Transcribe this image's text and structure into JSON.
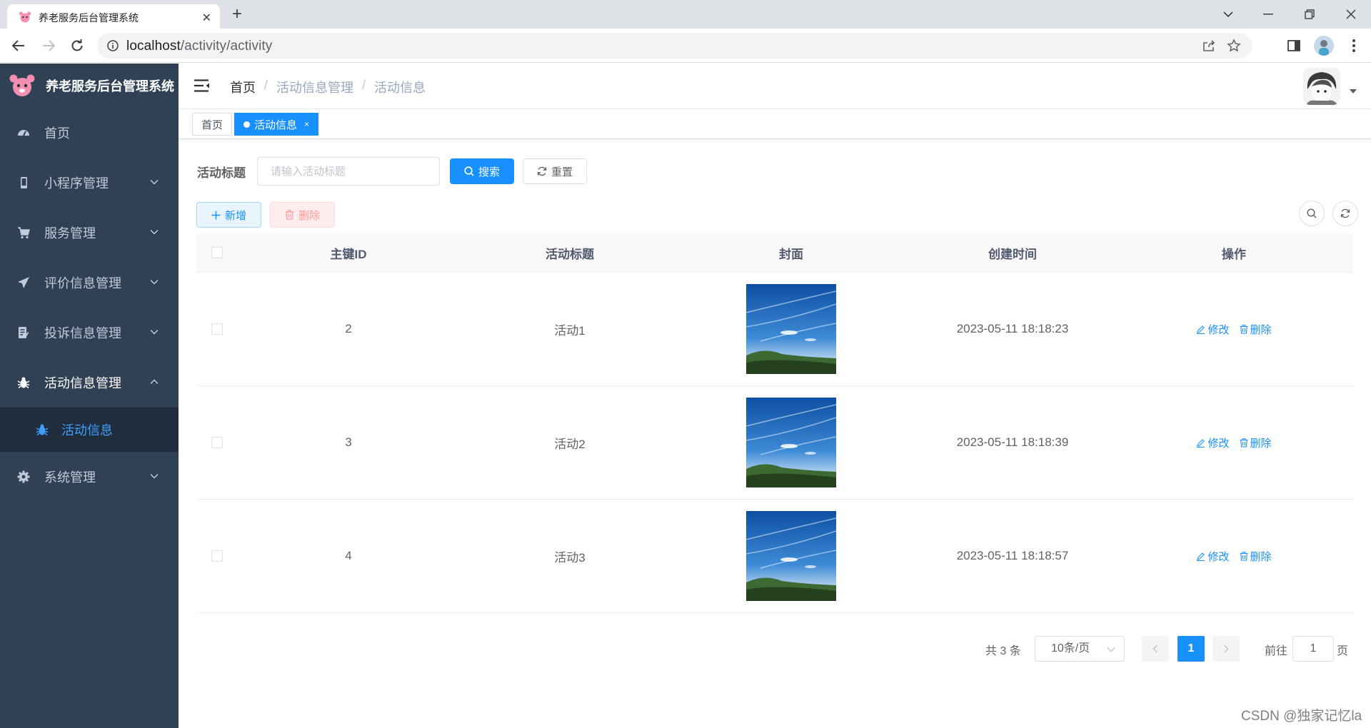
{
  "browser": {
    "tab_title": "养老服务后台管理系统",
    "url_host": "localhost",
    "url_path": "/activity/activity"
  },
  "sidebar": {
    "app_title": "养老服务后台管理系统",
    "items": [
      {
        "label": "首页",
        "icon": "dashboard-icon"
      },
      {
        "label": "小程序管理",
        "icon": "phone-icon"
      },
      {
        "label": "服务管理",
        "icon": "cart-icon"
      },
      {
        "label": "评价信息管理",
        "icon": "send-icon"
      },
      {
        "label": "投诉信息管理",
        "icon": "form-icon"
      },
      {
        "label": "活动信息管理",
        "icon": "bug-icon"
      },
      {
        "label": "活动信息",
        "icon": "bug-icon"
      },
      {
        "label": "系统管理",
        "icon": "gear-icon"
      }
    ]
  },
  "header": {
    "breadcrumb": [
      "首页",
      "活动信息管理",
      "活动信息"
    ]
  },
  "tags": {
    "home": "首页",
    "active": "活动信息",
    "close": "×"
  },
  "filter": {
    "label": "活动标题",
    "placeholder": "请输入活动标题",
    "search": "搜索",
    "reset": "重置"
  },
  "toolbar": {
    "add": "新增",
    "delete": "删除"
  },
  "table": {
    "columns": [
      "主键ID",
      "活动标题",
      "封面",
      "创建时间",
      "操作"
    ],
    "rows": [
      {
        "id": "2",
        "title": "活动1",
        "created": "2023-05-11 18:18:23",
        "edit": "修改",
        "del": "删除"
      },
      {
        "id": "3",
        "title": "活动2",
        "created": "2023-05-11 18:18:39",
        "edit": "修改",
        "del": "删除"
      },
      {
        "id": "4",
        "title": "活动3",
        "created": "2023-05-11 18:18:57",
        "edit": "修改",
        "del": "删除"
      }
    ]
  },
  "pagination": {
    "total": "共 3 条",
    "page_size": "10条/页",
    "current": "1",
    "goto_prefix": "前往",
    "goto_value": "1",
    "goto_suffix": "页"
  },
  "watermark": "CSDN @独家记忆la",
  "colors": {
    "primary": "#1890ff",
    "sidebar": "#304156",
    "active_menu": "#409eff"
  }
}
